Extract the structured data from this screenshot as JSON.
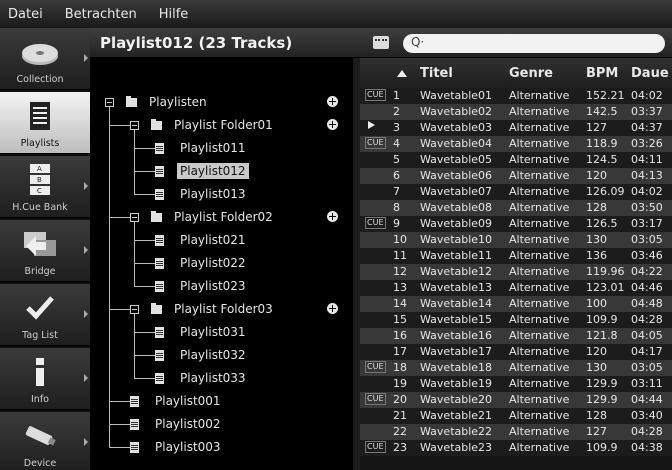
{
  "menu": [
    "Datei",
    "Betrachten",
    "Hilfe"
  ],
  "sidebar": [
    {
      "label": "Collection",
      "icon": "collection-icon",
      "active": false,
      "arrow": true
    },
    {
      "label": "Playlists",
      "icon": "playlists-icon",
      "active": true,
      "arrow": false
    },
    {
      "label": "H.Cue Bank",
      "icon": "hot-cue-bank-icon",
      "active": false,
      "arrow": true
    },
    {
      "label": "Bridge",
      "icon": "bridge-icon",
      "active": false,
      "arrow": true
    },
    {
      "label": "Tag List",
      "icon": "tag-list-icon",
      "active": false,
      "arrow": true
    },
    {
      "label": "Info",
      "icon": "info-icon",
      "active": false,
      "arrow": true
    },
    {
      "label": "Device",
      "icon": "device-icon",
      "active": false,
      "arrow": true
    }
  ],
  "header": {
    "title": "Playlist012 (23 Tracks)",
    "search_placeholder": "Q·"
  },
  "tree": [
    {
      "label": "Playlisten",
      "type": "root",
      "level": 0,
      "plus": true
    },
    {
      "label": "Playlist Folder01",
      "type": "folder",
      "level": 1,
      "plus": true
    },
    {
      "label": "Playlist011",
      "type": "playlist",
      "level": 2
    },
    {
      "label": "Playlist012",
      "type": "playlist",
      "level": 2,
      "selected": true
    },
    {
      "label": "Playlist013",
      "type": "playlist",
      "level": 2
    },
    {
      "label": "Playlist Folder02",
      "type": "folder",
      "level": 1,
      "plus": true
    },
    {
      "label": "Playlist021",
      "type": "playlist",
      "level": 2
    },
    {
      "label": "Playlist022",
      "type": "playlist",
      "level": 2
    },
    {
      "label": "Playlist023",
      "type": "playlist",
      "level": 2
    },
    {
      "label": "Playlist Folder03",
      "type": "folder",
      "level": 1,
      "plus": true
    },
    {
      "label": "Playlist031",
      "type": "playlist",
      "level": 2
    },
    {
      "label": "Playlist032",
      "type": "playlist",
      "level": 2
    },
    {
      "label": "Playlist033",
      "type": "playlist",
      "level": 2
    },
    {
      "label": "Playlist001",
      "type": "playlist",
      "level": 1
    },
    {
      "label": "Playlist002",
      "type": "playlist",
      "level": 1
    },
    {
      "label": "Playlist003",
      "type": "playlist",
      "level": 1
    }
  ],
  "table": {
    "columns": [
      "Titel",
      "Genre",
      "BPM",
      "Daue"
    ],
    "rows": [
      {
        "marker": "CUE",
        "num": "1",
        "title": "Wavetable01",
        "genre": "Alternative",
        "bpm": "152.21",
        "dur": "04:02"
      },
      {
        "marker": "",
        "num": "2",
        "title": "Wavetable02",
        "genre": "Alternative",
        "bpm": "142.5",
        "dur": "03:37"
      },
      {
        "marker": "PLAY",
        "num": "3",
        "title": "Wavetable03",
        "genre": "Alternative",
        "bpm": "127",
        "dur": "04:37"
      },
      {
        "marker": "CUE",
        "num": "4",
        "title": "Wavetable04",
        "genre": "Alternative",
        "bpm": "118.9",
        "dur": "03:26"
      },
      {
        "marker": "",
        "num": "5",
        "title": "Wavetable05",
        "genre": "Alternative",
        "bpm": "124.5",
        "dur": "04:11"
      },
      {
        "marker": "",
        "num": "6",
        "title": "Wavetable06",
        "genre": "Alternative",
        "bpm": "120",
        "dur": "04:13"
      },
      {
        "marker": "",
        "num": "7",
        "title": "Wavetable07",
        "genre": "Alternative",
        "bpm": "126.09",
        "dur": "04:02"
      },
      {
        "marker": "",
        "num": "8",
        "title": "Wavetable08",
        "genre": "Alternative",
        "bpm": "128",
        "dur": "03:50"
      },
      {
        "marker": "CUE",
        "num": "9",
        "title": "Wavetable09",
        "genre": "Alternative",
        "bpm": "126.5",
        "dur": "03:17"
      },
      {
        "marker": "",
        "num": "10",
        "title": "Wavetable10",
        "genre": "Alternative",
        "bpm": "130",
        "dur": "03:05"
      },
      {
        "marker": "",
        "num": "11",
        "title": "Wavetable11",
        "genre": "Alternative",
        "bpm": "136",
        "dur": "03:46"
      },
      {
        "marker": "",
        "num": "12",
        "title": "Wavetable12",
        "genre": "Alternative",
        "bpm": "119.96",
        "dur": "04:22"
      },
      {
        "marker": "",
        "num": "13",
        "title": "Wavetable13",
        "genre": "Alternative",
        "bpm": "123.01",
        "dur": "04:46"
      },
      {
        "marker": "",
        "num": "14",
        "title": "Wavetable14",
        "genre": "Alternative",
        "bpm": "100",
        "dur": "04:48"
      },
      {
        "marker": "",
        "num": "15",
        "title": "Wavetable15",
        "genre": "Alternative",
        "bpm": "109.9",
        "dur": "04:28"
      },
      {
        "marker": "",
        "num": "16",
        "title": "Wavetable16",
        "genre": "Alternative",
        "bpm": "121.8",
        "dur": "04:05"
      },
      {
        "marker": "",
        "num": "17",
        "title": "Wavetable17",
        "genre": "Alternative",
        "bpm": "120",
        "dur": "04:17"
      },
      {
        "marker": "CUE",
        "num": "18",
        "title": "Wavetable18",
        "genre": "Alternative",
        "bpm": "130",
        "dur": "03:05"
      },
      {
        "marker": "",
        "num": "19",
        "title": "Wavetable19",
        "genre": "Alternative",
        "bpm": "129.9",
        "dur": "03:11"
      },
      {
        "marker": "CUE",
        "num": "20",
        "title": "Wavetable20",
        "genre": "Alternative",
        "bpm": "129.9",
        "dur": "04:44"
      },
      {
        "marker": "",
        "num": "21",
        "title": "Wavetable21",
        "genre": "Alternative",
        "bpm": "128",
        "dur": "03:40"
      },
      {
        "marker": "",
        "num": "22",
        "title": "Wavetable22",
        "genre": "Alternative",
        "bpm": "127",
        "dur": "04:28"
      },
      {
        "marker": "CUE",
        "num": "23",
        "title": "Wavetable23",
        "genre": "Alternative",
        "bpm": "109.9",
        "dur": "04:38"
      }
    ]
  }
}
